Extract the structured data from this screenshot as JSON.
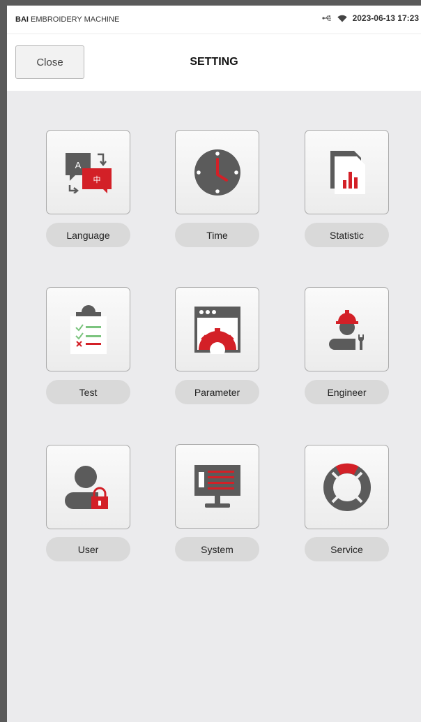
{
  "statusbar": {
    "brand_bold": "BAI",
    "brand_rest": " EMBROIDERY MACHINE",
    "datetime": "2023-06-13 17:23",
    "icons": [
      "usb-icon",
      "wifi-icon"
    ]
  },
  "header": {
    "close_label": "Close",
    "title": "SETTING"
  },
  "settings": [
    {
      "label": "Language",
      "icon": "language-icon"
    },
    {
      "label": "Time",
      "icon": "clock-icon"
    },
    {
      "label": "Statistic",
      "icon": "statistic-icon"
    },
    {
      "label": "Test",
      "icon": "checklist-icon"
    },
    {
      "label": "Parameter",
      "icon": "parameter-gear-icon"
    },
    {
      "label": "Engineer",
      "icon": "engineer-icon"
    },
    {
      "label": "User",
      "icon": "user-lock-icon"
    },
    {
      "label": "System",
      "icon": "system-monitor-icon"
    },
    {
      "label": "Service",
      "icon": "lifebuoy-icon"
    }
  ],
  "icon_text": {
    "language_a": "A",
    "language_zh": "中"
  },
  "colors": {
    "accent_red": "#d32027",
    "icon_gray": "#5b5b5b",
    "check_green": "#7cc47f"
  }
}
